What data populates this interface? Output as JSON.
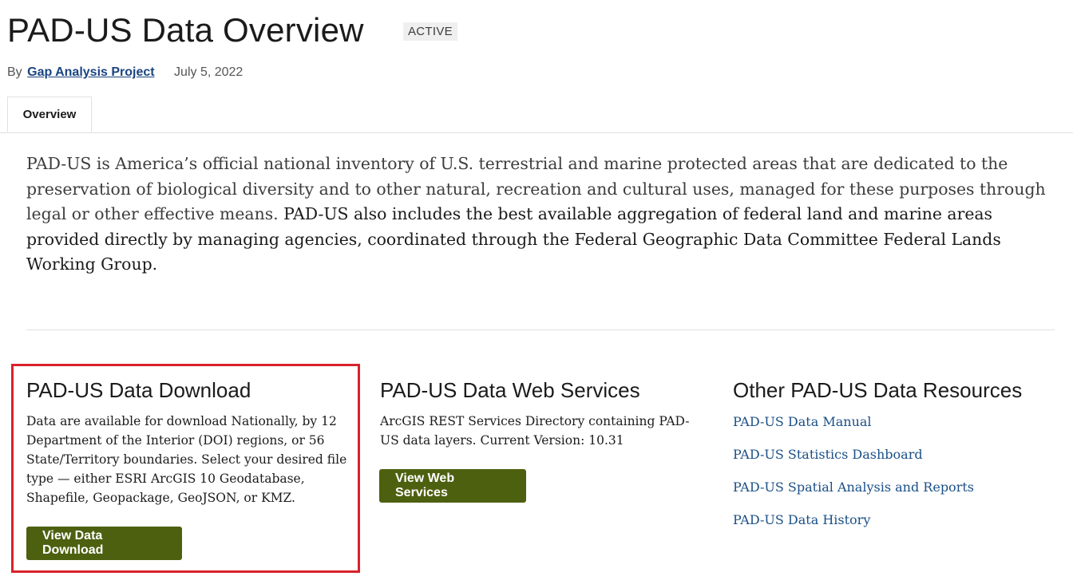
{
  "page": {
    "title": "PAD-US Data Overview",
    "status_badge": "ACTIVE",
    "byline_prefix": "By",
    "author": "Gap Analysis Project",
    "date": "July 5, 2022"
  },
  "tabs": [
    {
      "label": "Overview"
    }
  ],
  "intro": {
    "part1": "PAD-US is America’s official national inventory of U.S. terrestrial and marine protected areas that are dedicated to the preservation of biological diversity and to other natural, recreation and cultural uses, managed for these purposes through legal or other effective means. ",
    "part2": "PAD-US also includes the best available aggregation of federal land and marine areas provided directly by managing agencies, coordinated through the Federal Geographic Data Committee Federal Lands Working Group."
  },
  "download": {
    "heading": "PAD-US Data Download",
    "text": "Data are available for download Nationally, by 12 Department of the Interior (DOI) regions, or 56 State/Territory boundaries. Select your desired file type — either ESRI ArcGIS 10 Geodatabase, Shapefile, Geopackage, GeoJSON, or KMZ.",
    "button": "View Data Download"
  },
  "services": {
    "heading": "PAD-US Data Web Services",
    "text": "ArcGIS REST Services Directory containing PAD-US data layers. Current Version: 10.31",
    "button": "View Web Services"
  },
  "resources": {
    "heading": "Other PAD-US Data Resources",
    "links": [
      {
        "label": "PAD-US Data Manual"
      },
      {
        "label": "PAD-US Statistics Dashboard"
      },
      {
        "label": "PAD-US Spatial Analysis and Reports"
      },
      {
        "label": "PAD-US Data History"
      }
    ]
  },
  "colors": {
    "button_bg": "#4d6010",
    "link": "#1a4f86",
    "highlight_border": "#d8222a"
  }
}
